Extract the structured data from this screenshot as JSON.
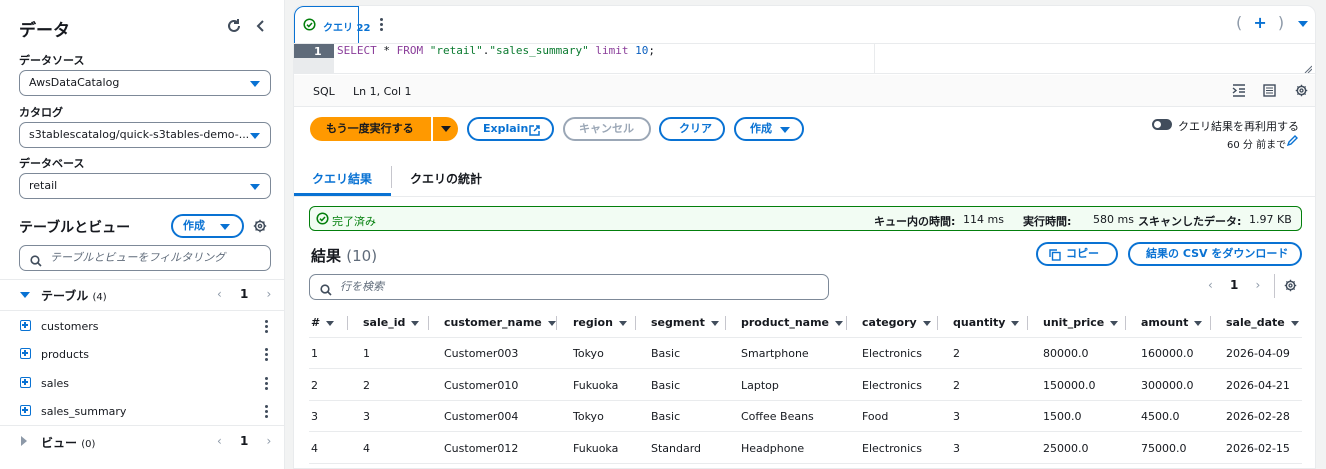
{
  "left": {
    "title": "データ",
    "datasource": {
      "label": "データソース",
      "value": "AwsDataCatalog"
    },
    "catalog": {
      "label": "カタログ",
      "value": "s3tablescatalog/quick-s3tables-demo-..."
    },
    "database": {
      "label": "データベース",
      "value": "retail"
    },
    "tables_views": {
      "title": "テーブルとビュー",
      "create_label": "作成",
      "filter_placeholder": "テーブルとビューをフィルタリング"
    },
    "tables": {
      "label": "テーブル",
      "count": "(4)",
      "page": "1",
      "items": [
        "customers",
        "products",
        "sales",
        "sales_summary"
      ]
    },
    "views": {
      "label": "ビュー",
      "count": "(0)",
      "page": "1"
    }
  },
  "tab": {
    "label": "クエリ 22"
  },
  "editor": {
    "line_no": "1",
    "sql_parts": {
      "kw1": "SELECT",
      "star": " * ",
      "kw2": "FROM",
      "sp": " ",
      "str1": "\"retail\"",
      "dot": ".",
      "str2": "\"sales_summary\"",
      "sp2": " ",
      "kw3": "limit",
      "num": " 10",
      "semi": ";"
    },
    "mode": "SQL",
    "cursor": "Ln 1, Col 1"
  },
  "toolbar": {
    "run_again": "もう一度実行する",
    "explain": "Explain",
    "cancel": "キャンセル",
    "clear": "クリア",
    "create": "作成",
    "reuse_label": "クエリ結果を再利用する",
    "reuse_sub": "60 分 前まで"
  },
  "result_tabs": [
    "クエリ結果",
    "クエリの統計"
  ],
  "status": {
    "text": "完了済み",
    "queue_label": "キュー内の時間:",
    "queue_value": "114 ms",
    "exec_label": "実行時間:",
    "exec_value": "580 ms",
    "scan_label": "スキャンしたデータ:",
    "scan_value": "1.97 KB"
  },
  "results": {
    "title": "結果",
    "count": "(10)",
    "copy_label": "コピー",
    "download_label": "結果の CSV をダウンロード",
    "search_placeholder": "行を検索",
    "page": "1",
    "columns": [
      "#",
      "sale_id",
      "customer_name",
      "region",
      "segment",
      "product_name",
      "category",
      "quantity",
      "unit_price",
      "amount",
      "sale_date"
    ],
    "rows": [
      [
        "1",
        "1",
        "Customer003",
        "Tokyo",
        "Basic",
        "Smartphone",
        "Electronics",
        "2",
        "80000.0",
        "160000.0",
        "2026-04-09"
      ],
      [
        "2",
        "2",
        "Customer010",
        "Fukuoka",
        "Basic",
        "Laptop",
        "Electronics",
        "2",
        "150000.0",
        "300000.0",
        "2026-04-21"
      ],
      [
        "3",
        "3",
        "Customer004",
        "Tokyo",
        "Basic",
        "Coffee Beans",
        "Food",
        "3",
        "1500.0",
        "4500.0",
        "2026-02-28"
      ],
      [
        "4",
        "4",
        "Customer012",
        "Fukuoka",
        "Standard",
        "Headphone",
        "Electronics",
        "3",
        "25000.0",
        "75000.0",
        "2026-02-15"
      ]
    ]
  },
  "colors": {
    "accent": "#0972d3",
    "primary": "#ff9900",
    "success": "#037f0c"
  }
}
